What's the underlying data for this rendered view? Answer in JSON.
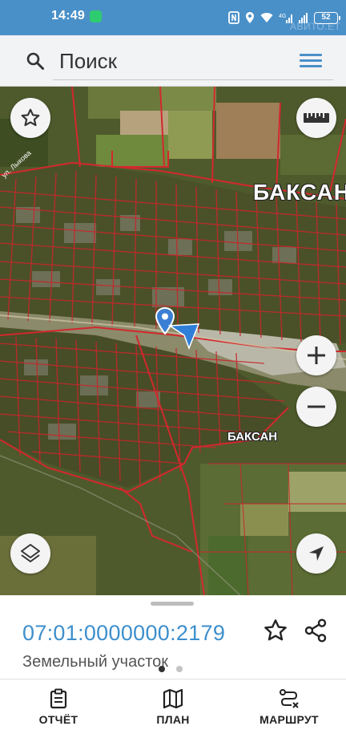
{
  "status_bar": {
    "time": "14:49",
    "battery": "52",
    "watermark": "АВИТО.ЕТ"
  },
  "search": {
    "placeholder": "Поиск"
  },
  "map": {
    "city_label_big": "БАКСАН",
    "city_label_small": "БАКСАН",
    "road_label": "ул. Лыкова"
  },
  "parcel": {
    "cadastral_number": "07:01:0000000:2179",
    "type": "Земельный участок"
  },
  "bottom_nav": {
    "report_label": "ОТЧЁТ",
    "plan_label": "ПЛАН",
    "route_label": "МАРШРУТ"
  },
  "colors": {
    "status_bar": "#4a90c8",
    "accent": "#3d8fcd",
    "parcel_lines": "#c8262c"
  },
  "icons": {
    "search": "search-icon",
    "menu": "menu-icon",
    "favorite": "star-outline-icon",
    "ruler": "ruler-icon",
    "zoom_in": "plus-icon",
    "zoom_out": "minus-icon",
    "layers": "layers-icon",
    "locate": "navigation-arrow-icon",
    "share": "share-icon",
    "report": "clipboard-icon",
    "plan": "map-icon",
    "route": "route-icon"
  }
}
